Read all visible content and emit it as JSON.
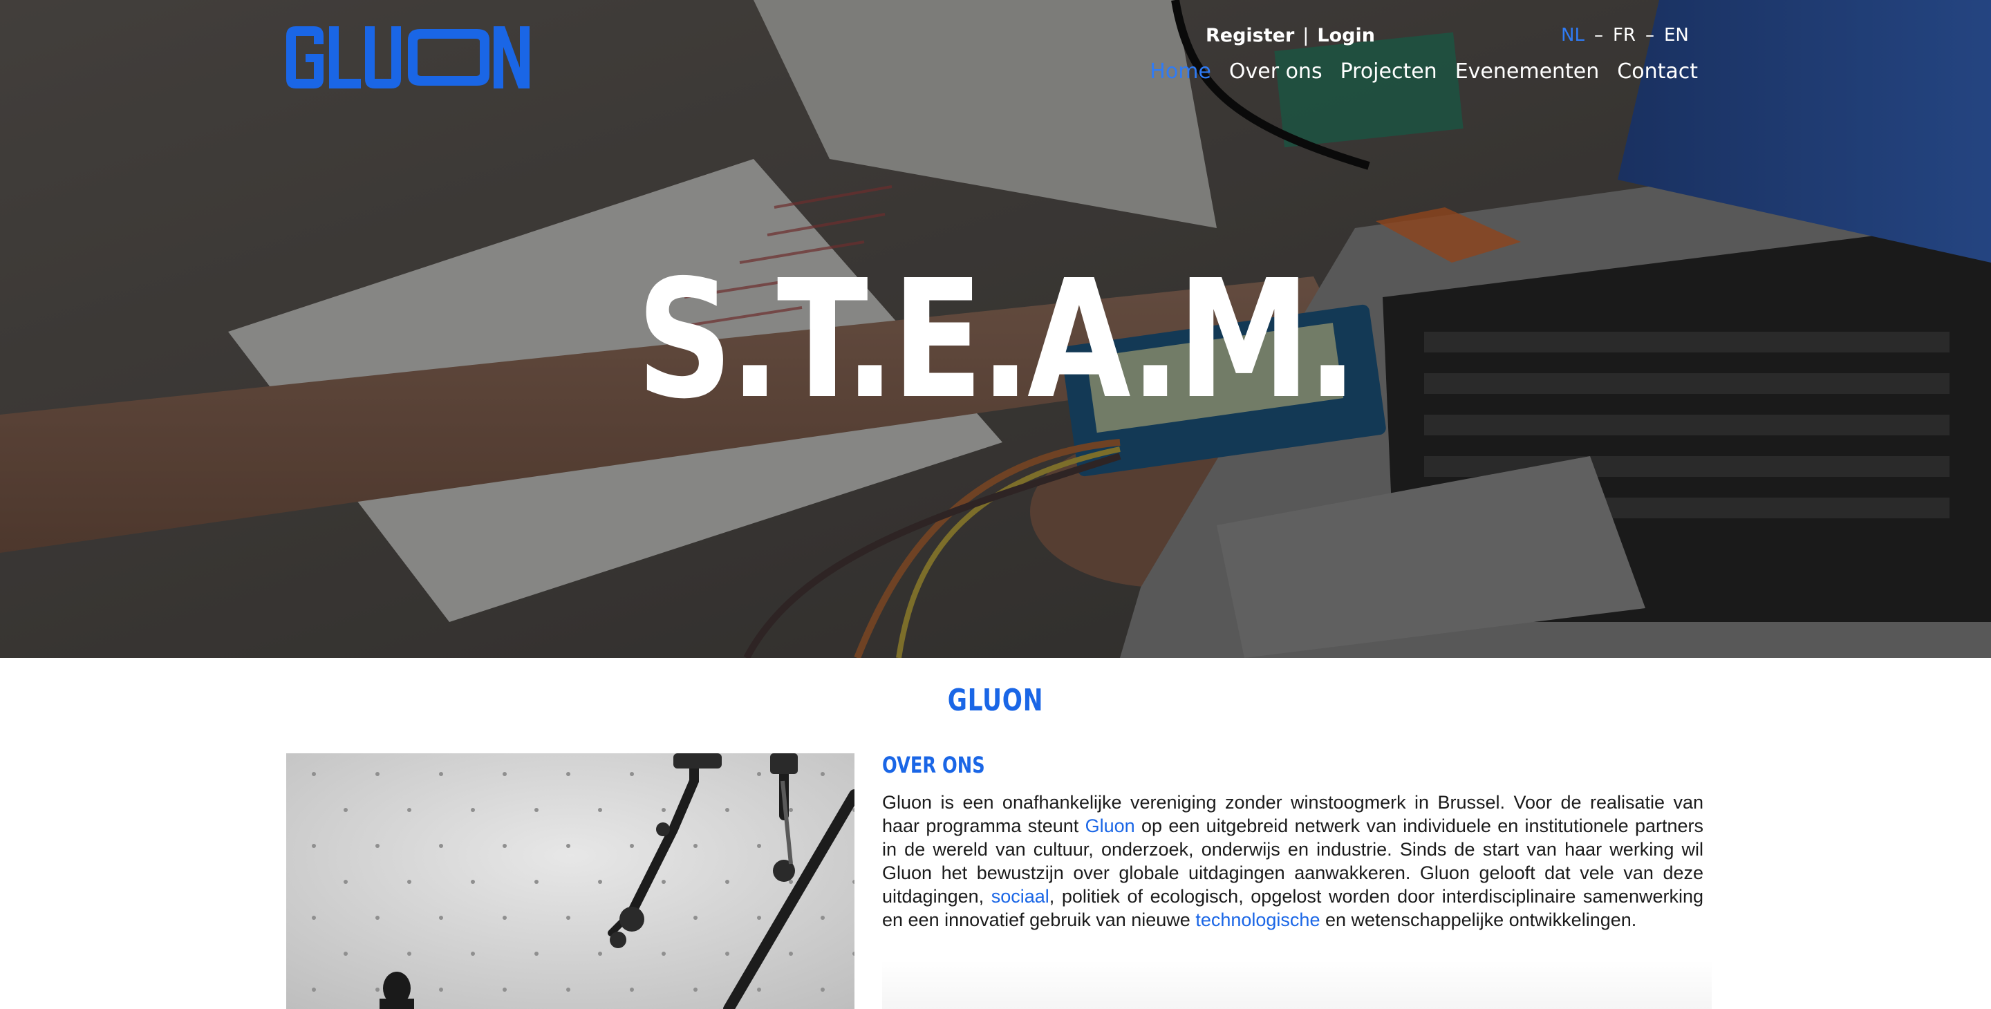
{
  "brand": {
    "logo_text": "GLUON",
    "accent_color": "#1a66e6"
  },
  "header": {
    "auth": {
      "register": "Register",
      "separator": "|",
      "login": "Login"
    },
    "languages": [
      {
        "code": "NL",
        "active": true
      },
      {
        "code": "FR",
        "active": false
      },
      {
        "code": "EN",
        "active": false
      }
    ],
    "language_separator": "–",
    "nav": [
      {
        "label": "Home",
        "active": true
      },
      {
        "label": "Over ons",
        "active": false
      },
      {
        "label": "Projecten",
        "active": false
      },
      {
        "label": "Evenementen",
        "active": false
      },
      {
        "label": "Contact",
        "active": false
      }
    ]
  },
  "hero": {
    "title": "S.T.E.A.M."
  },
  "main": {
    "section_title": "GLUON",
    "about": {
      "heading": "OVER ONS",
      "text_parts": [
        {
          "text": "Gluon is een onafhankelijke vereniging zonder winstoogmerk in Brussel. Voor de realisatie van haar programma steunt ",
          "link": false
        },
        {
          "text": "Gluon",
          "link": true
        },
        {
          "text": " op een uitgebreid netwerk van individuele en institutionele partners in de wereld van cultuur, onderzoek, onderwijs en industrie. Sinds de start van haar werking wil Gluon het bewustzijn over globale uitdagingen aanwakkeren. Gluon gelooft dat vele van deze uitdagingen, ",
          "link": false
        },
        {
          "text": "sociaal",
          "link": true
        },
        {
          "text": ", politiek of ecologisch, opgelost worden door interdisciplinaire samenwerking en een innovatief gebruik van nieuwe ",
          "link": false
        },
        {
          "text": "technologische",
          "link": true
        },
        {
          "text": " en wetenschappelijke ontwikkelingen.",
          "link": false
        }
      ]
    }
  }
}
